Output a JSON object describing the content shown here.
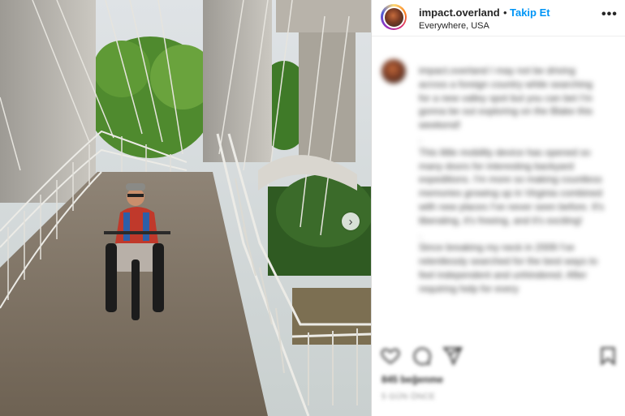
{
  "post": {
    "username": "impact.overland",
    "separator": "•",
    "follow_label": "Takip Et",
    "location": "Everywhere, USA",
    "more_label": "•••",
    "next_icon": "chevron-right-icon",
    "next_label": "›"
  },
  "caption": {
    "text": "impact.overland I may not be driving across a foreign country while searching for a new valley spot but you can bet I'm gonna be out exploring on the Blake this weekend!\n.\nThis little mobility device has opened so many doors for interesting backyard expeditions. I'm more so making countless memories growing up in Virginia combined with new places I've never seen before. It's liberating, it's freeing, and it's exciting!\n.\nSince breaking my neck in 2009 I've relentlessly searched for the best ways to feel independent and unhindered. After requiring help for every"
  },
  "actions": {
    "like_icon": "heart-icon",
    "comment_icon": "comment-icon",
    "share_icon": "share-icon",
    "save_icon": "bookmark-icon"
  },
  "meta": {
    "likes": "845 beğenme",
    "time": "5 GÜN ÖNCE"
  }
}
